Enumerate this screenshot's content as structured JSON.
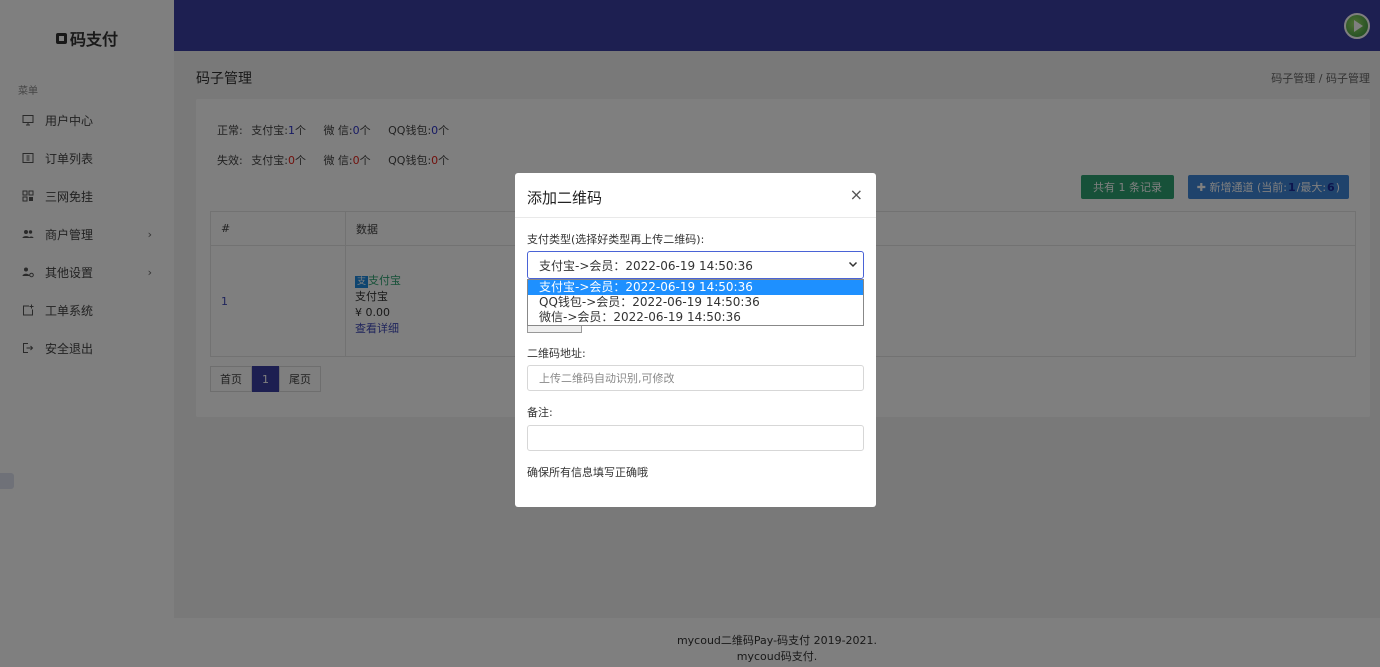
{
  "brand": {
    "name": "码支付"
  },
  "sidebar": {
    "menu_title": "菜单",
    "items": [
      {
        "label": "用户中心",
        "icon": "monitor-icon",
        "has_arrow": false
      },
      {
        "label": "订单列表",
        "icon": "order-icon",
        "has_arrow": false
      },
      {
        "label": "三网免挂",
        "icon": "grid-icon",
        "has_arrow": false
      },
      {
        "label": "商户管理",
        "icon": "users-icon",
        "has_arrow": true
      },
      {
        "label": "其他设置",
        "icon": "settings-icon",
        "has_arrow": true
      },
      {
        "label": "工单系统",
        "icon": "ticket-icon",
        "has_arrow": false
      },
      {
        "label": "安全退出",
        "icon": "logout-icon",
        "has_arrow": false
      }
    ],
    "arrow": "›"
  },
  "page": {
    "title": "码子管理",
    "breadcrumb": "码子管理 / 码子管理"
  },
  "stats": {
    "normal_label": "正常:",
    "invalid_label": "失效:",
    "normal": {
      "alipay_label": "支付宝:",
      "alipay_count": "1",
      "wechat_label": "微 信:",
      "wechat_count": "0",
      "qq_label": "QQ钱包:",
      "qq_count": "0",
      "unit": "个"
    },
    "invalid": {
      "alipay_label": "支付宝:",
      "alipay_count": "0",
      "wechat_label": "微 信:",
      "wechat_count": "0",
      "qq_label": "QQ钱包:",
      "qq_count": "0",
      "unit": "个"
    }
  },
  "actions": {
    "total_records": "共有 1 条记录",
    "add_channel_prefix": "✚ 新增通道 (当前:",
    "add_channel_current": "1",
    "add_channel_mid": "/最大:",
    "add_channel_max": "6",
    "add_channel_suffix": ")"
  },
  "table": {
    "headers": [
      "#",
      "数据"
    ],
    "rows": [
      {
        "id": "1",
        "tag": "支",
        "type": "支付宝",
        "name": "支付宝",
        "amount": "¥ 0.00",
        "detail": "查看详细"
      }
    ]
  },
  "pager": {
    "first": "首页",
    "current": "1",
    "last": "尾页"
  },
  "footer": {
    "line1": "mycoud二维码Pay-码支付 2019-2021.",
    "line2": "mycoud码支付."
  },
  "modal": {
    "title": "添加二维码",
    "close": "×",
    "type_label": "支付类型(选择好类型再上传二维码):",
    "selected": "支付宝->会员：2022-06-19 14:50:36",
    "options": [
      "支付宝->会员：2022-06-19 14:50:36",
      "QQ钱包->会员：2022-06-19 14:50:36",
      "微信->会员：2022-06-19 14:50:36"
    ],
    "qr_label": "二维码地址:",
    "qr_placeholder": "上传二维码自动识别,可修改",
    "note_label": "备注:",
    "note_value": "",
    "hint": "确保所有信息填写正确哦"
  },
  "colors": {
    "topbar": "#3a3ea3",
    "green": "#2fa372",
    "blue": "#3e86d8",
    "select_highlight": "#1e90ff"
  }
}
